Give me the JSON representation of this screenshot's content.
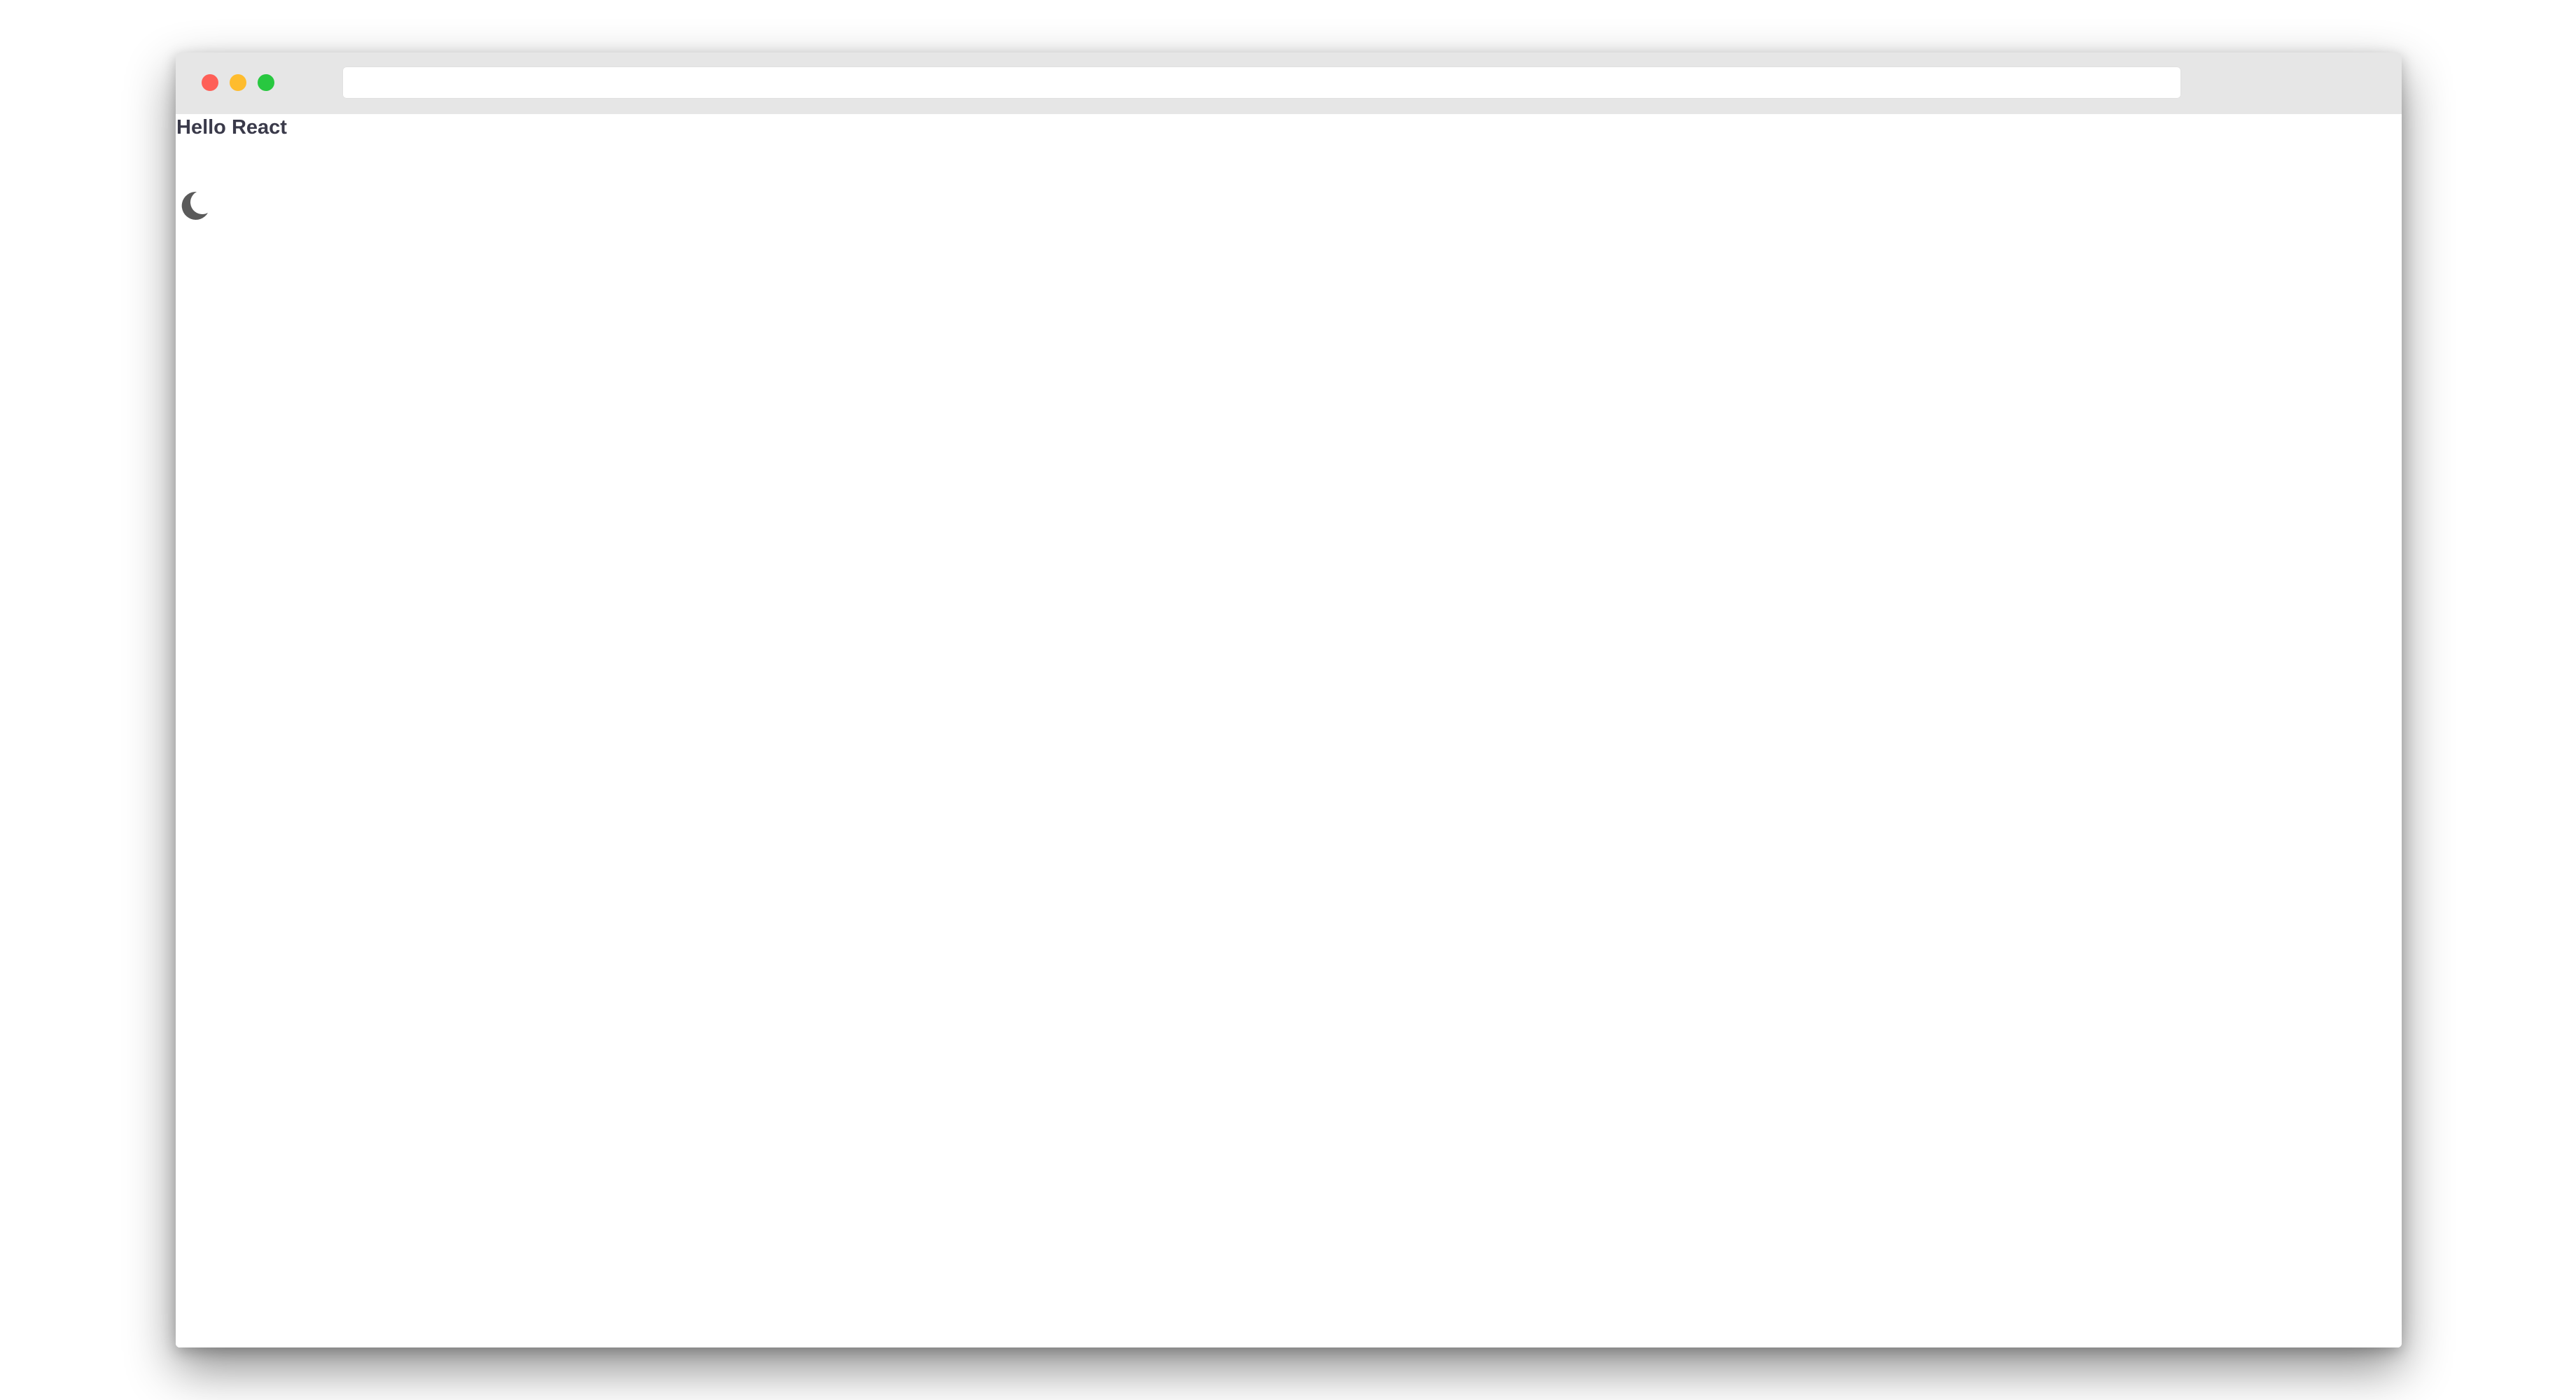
{
  "window": {
    "controls": {
      "close": "#fe5f57",
      "minimize": "#febc2e",
      "maximize": "#28c840"
    },
    "address_bar": {
      "value": ""
    }
  },
  "page": {
    "heading": "Hello React",
    "theme_toggle": {
      "icon": "moon-icon",
      "color": "#5a5a5a"
    }
  }
}
